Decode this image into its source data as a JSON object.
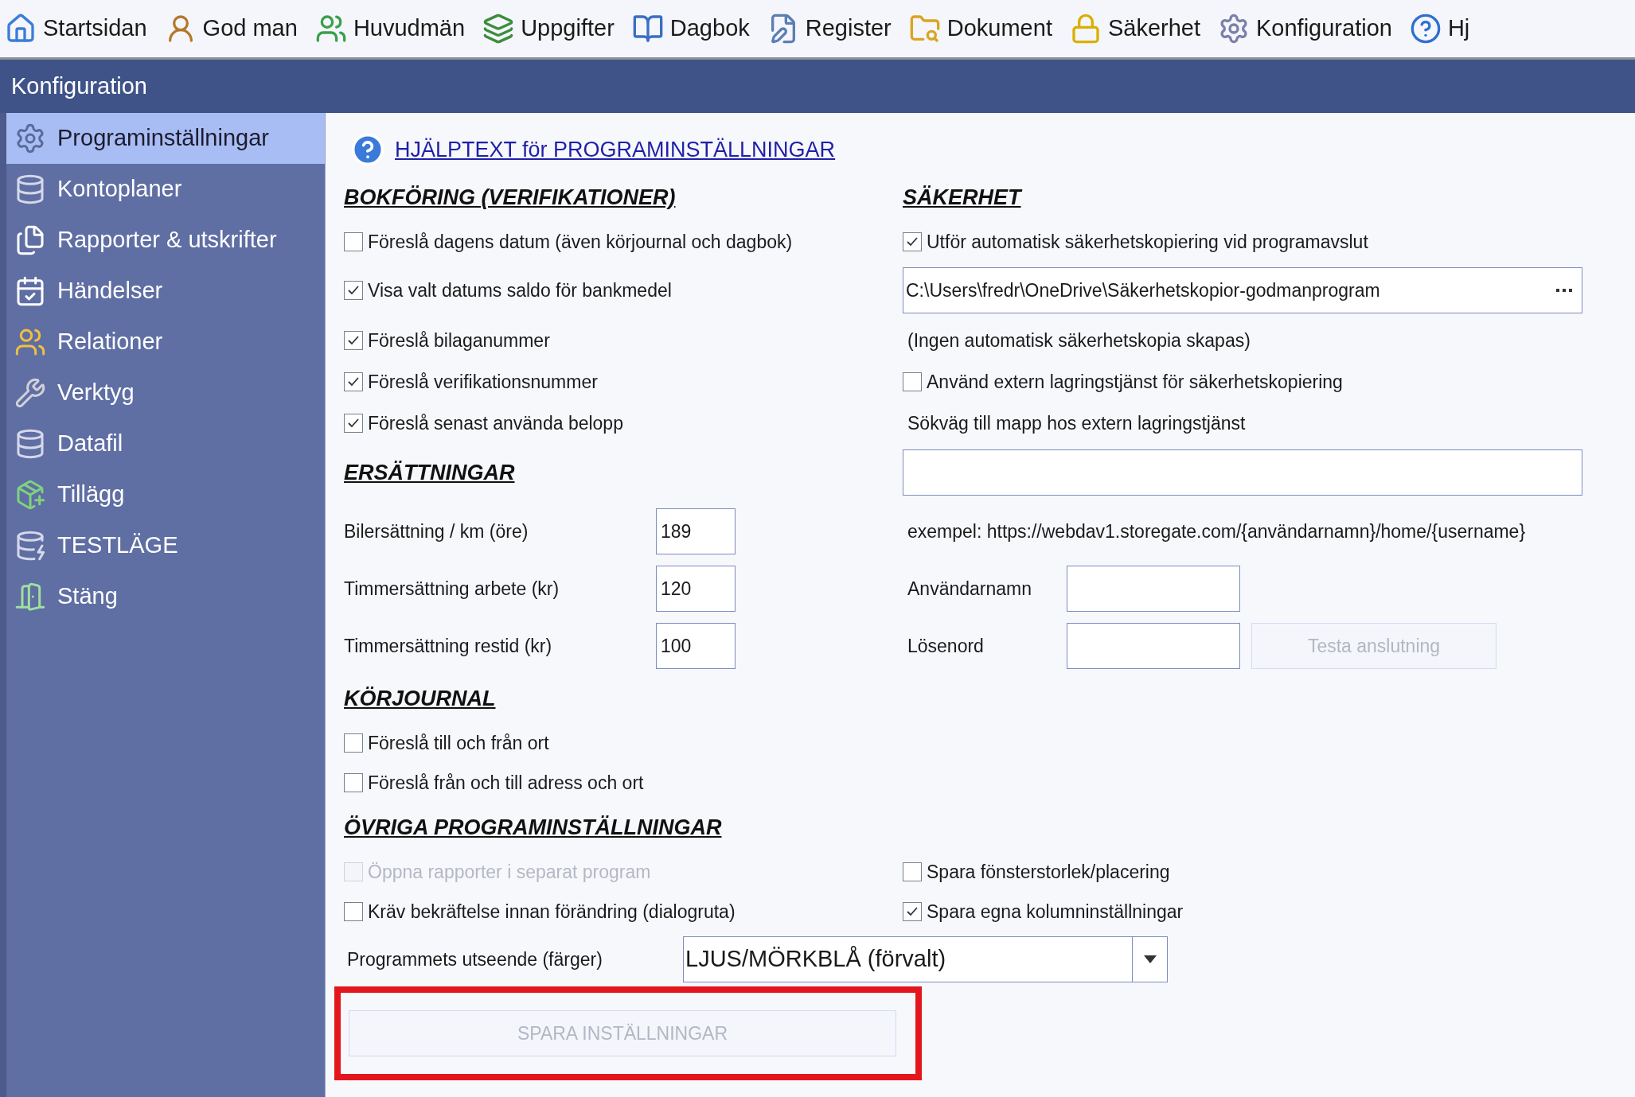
{
  "toolbar": [
    {
      "label": "Startsidan"
    },
    {
      "label": "God man"
    },
    {
      "label": "Huvudmän"
    },
    {
      "label": "Uppgifter"
    },
    {
      "label": "Dagbok"
    },
    {
      "label": "Register"
    },
    {
      "label": "Dokument"
    },
    {
      "label": "Säkerhet"
    },
    {
      "label": "Konfiguration"
    },
    {
      "label": "Hj"
    }
  ],
  "page_title": "Konfiguration",
  "sidebar": {
    "items": [
      {
        "label": "Programinställningar",
        "selected": true
      },
      {
        "label": "Kontoplaner",
        "selected": false
      },
      {
        "label": "Rapporter & utskrifter",
        "selected": false
      },
      {
        "label": "Händelser",
        "selected": false
      },
      {
        "label": "Relationer",
        "selected": false
      },
      {
        "label": "Verktyg",
        "selected": false
      },
      {
        "label": "Datafil",
        "selected": false
      },
      {
        "label": "Tillägg",
        "selected": false
      },
      {
        "label": "TESTLÄGE",
        "selected": false
      },
      {
        "label": "Stäng",
        "selected": false
      }
    ]
  },
  "help_link": "HJÄLPTEXT för PROGRAMINSTÄLLNINGAR",
  "left_column": [
    {
      "kind": "heading",
      "text": "BOKFÖRING (VERIFIKATIONER)"
    },
    {
      "kind": "checkbox",
      "label": "Föreslå dagens datum (även körjournal och dagbok)",
      "checked": false,
      "disabled": false
    },
    {
      "kind": "checkbox",
      "label": "Visa valt datums saldo för bankmedel",
      "checked": true,
      "disabled": false
    },
    {
      "kind": "checkbox",
      "label": "Föreslå bilaganummer",
      "checked": true,
      "disabled": false
    },
    {
      "kind": "checkbox",
      "label": "Föreslå verifikationsnummer",
      "checked": true,
      "disabled": false
    },
    {
      "kind": "checkbox",
      "label": "Föreslå senast använda belopp",
      "checked": true,
      "disabled": false
    },
    {
      "kind": "heading",
      "text": "ERSÄTTNINGAR"
    },
    {
      "kind": "number",
      "label": "Bilersättning / km (öre)",
      "value": "189"
    },
    {
      "kind": "number",
      "label": "Timmersättning arbete (kr)",
      "value": "120"
    },
    {
      "kind": "number",
      "label": "Timmersättning restid (kr)",
      "value": "100"
    }
  ],
  "right_column": [
    {
      "kind": "heading",
      "text": "SÄKERHET"
    },
    {
      "kind": "checkbox",
      "label": "Utför automatisk säkerhetskopiering vid programavslut",
      "checked": true,
      "disabled": false
    },
    {
      "kind": "path",
      "value": "C:\\Users\\fredr\\OneDrive\\Säkerhetskopior-godmanprogram"
    },
    {
      "kind": "text",
      "text": "(Ingen automatisk säkerhetskopia skapas)"
    },
    {
      "kind": "checkbox",
      "label": "Använd extern lagringstjänst för säkerhetskopiering",
      "checked": false,
      "disabled": false
    },
    {
      "kind": "text",
      "text": "Sökväg till mapp hos extern lagringstjänst"
    },
    {
      "kind": "input"
    },
    {
      "kind": "text",
      "text": "exempel: https://webdav1.storegate.com/{användarnamn}/home/{username}"
    },
    {
      "kind": "login",
      "label": "Användarnamn"
    },
    {
      "kind": "login",
      "label": "Lösenord",
      "button": {
        "label": "Testa anslutning",
        "disabled": true
      }
    }
  ],
  "korjournal": {
    "heading": "KÖRJOURNAL",
    "options": [
      {
        "label": "Föreslå till och från ort",
        "checked": false,
        "disabled": false
      },
      {
        "label": "Föreslå från och till adress och ort",
        "checked": false,
        "disabled": false
      }
    ]
  },
  "ovriga": {
    "heading": "ÖVRIGA PROGRAMINSTÄLLNINGAR",
    "left": [
      {
        "label": "Öppna rapporter i separat program",
        "checked": false,
        "disabled": true
      },
      {
        "label": "Kräv bekräftelse innan förändring (dialogruta)",
        "checked": false,
        "disabled": false
      }
    ],
    "right": [
      {
        "label": "Spara fönsterstorlek/placering",
        "checked": false,
        "disabled": false
      },
      {
        "label": "Spara egna kolumninställningar",
        "checked": true,
        "disabled": false
      }
    ],
    "appearance": {
      "label": "Programmets utseende (färger)",
      "value": "LJUS/MÖRKBLÅ (förvalt)"
    },
    "save_button": {
      "label": "SPARA INSTÄLLNINGAR",
      "disabled": true,
      "highlighted": true
    }
  }
}
